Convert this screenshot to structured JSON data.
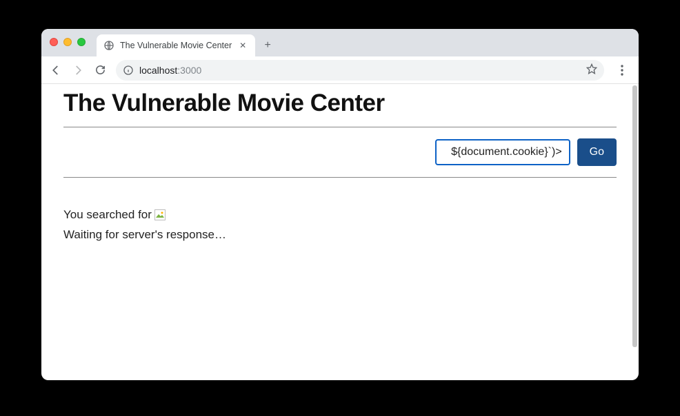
{
  "window": {
    "tab_title": "The Vulnerable Movie Center"
  },
  "toolbar": {
    "url_host": "localhost",
    "url_port": ":3000"
  },
  "page": {
    "title": "The Vulnerable Movie Center",
    "search_value": "${document.cookie}`)>",
    "go_label": "Go",
    "result_prefix": "You searched for ",
    "waiting_text": "Waiting for server's response…"
  }
}
